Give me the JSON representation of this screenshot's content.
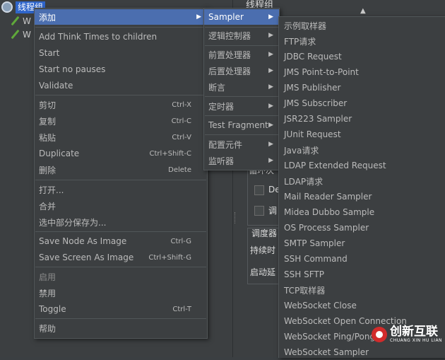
{
  "tree": {
    "root_label": "线程组",
    "children": [
      "W",
      "W"
    ]
  },
  "right_panel": {
    "title_fragment": "线程组",
    "loop_fragment": "循环次",
    "check1": "De",
    "check2": "调",
    "scheduler_title": "调度器",
    "duration_label": "持续时",
    "startup_delay_label": "启动延"
  },
  "context_menu": {
    "items": [
      {
        "label": "添加",
        "submenu": true,
        "selected": true
      },
      {
        "label": "Add Think Times to children"
      },
      {
        "label": "Start"
      },
      {
        "label": "Start no pauses"
      },
      {
        "label": "Validate"
      },
      {
        "label": "剪切",
        "shortcut": "Ctrl-X"
      },
      {
        "label": "复制",
        "shortcut": "Ctrl-C"
      },
      {
        "label": "粘贴",
        "shortcut": "Ctrl-V"
      },
      {
        "label": "Duplicate",
        "shortcut": "Ctrl+Shift-C"
      },
      {
        "label": "删除",
        "shortcut": "Delete"
      },
      {
        "label": "打开..."
      },
      {
        "label": "合并"
      },
      {
        "label": "选中部分保存为..."
      },
      {
        "label": "Save Node As Image",
        "shortcut": "Ctrl-G"
      },
      {
        "label": "Save Screen As Image",
        "shortcut": "Ctrl+Shift-G"
      },
      {
        "label": "启用",
        "disabled": true
      },
      {
        "label": "禁用"
      },
      {
        "label": "Toggle",
        "shortcut": "Ctrl-T"
      },
      {
        "label": "帮助"
      }
    ]
  },
  "add_menu": {
    "items": [
      {
        "label": "Sampler",
        "selected": true
      },
      {
        "label": "逻辑控制器"
      },
      {
        "label": "前置处理器"
      },
      {
        "label": "后置处理器"
      },
      {
        "label": "断言"
      },
      {
        "label": "定时器"
      },
      {
        "label": "Test Fragment"
      },
      {
        "label": "配置元件"
      },
      {
        "label": "监听器"
      }
    ]
  },
  "sampler_menu": {
    "items": [
      "示例取样器",
      "FTP请求",
      "JDBC Request",
      "JMS Point-to-Point",
      "JMS Publisher",
      "JMS Subscriber",
      "JSR223 Sampler",
      "JUnit Request",
      "Java请求",
      "LDAP Extended Request",
      "LDAP请求",
      "Mail Reader Sampler",
      "Midea Dubbo Sample",
      "OS Process Sampler",
      "SMTP Sampler",
      "SSH Command",
      "SSH SFTP",
      "TCP取样器",
      "WebSocket Close",
      "WebSocket Open Connection",
      "WebSocket Ping/Pong",
      "WebSocket Sampler"
    ]
  },
  "watermark": {
    "title": "创新互联",
    "subtitle": "CHUANG XIN HU LIAN"
  },
  "colors": {
    "menu_bg": "#3c3f41",
    "selection": "#4b6eaf",
    "text": "#bbbbbb"
  }
}
